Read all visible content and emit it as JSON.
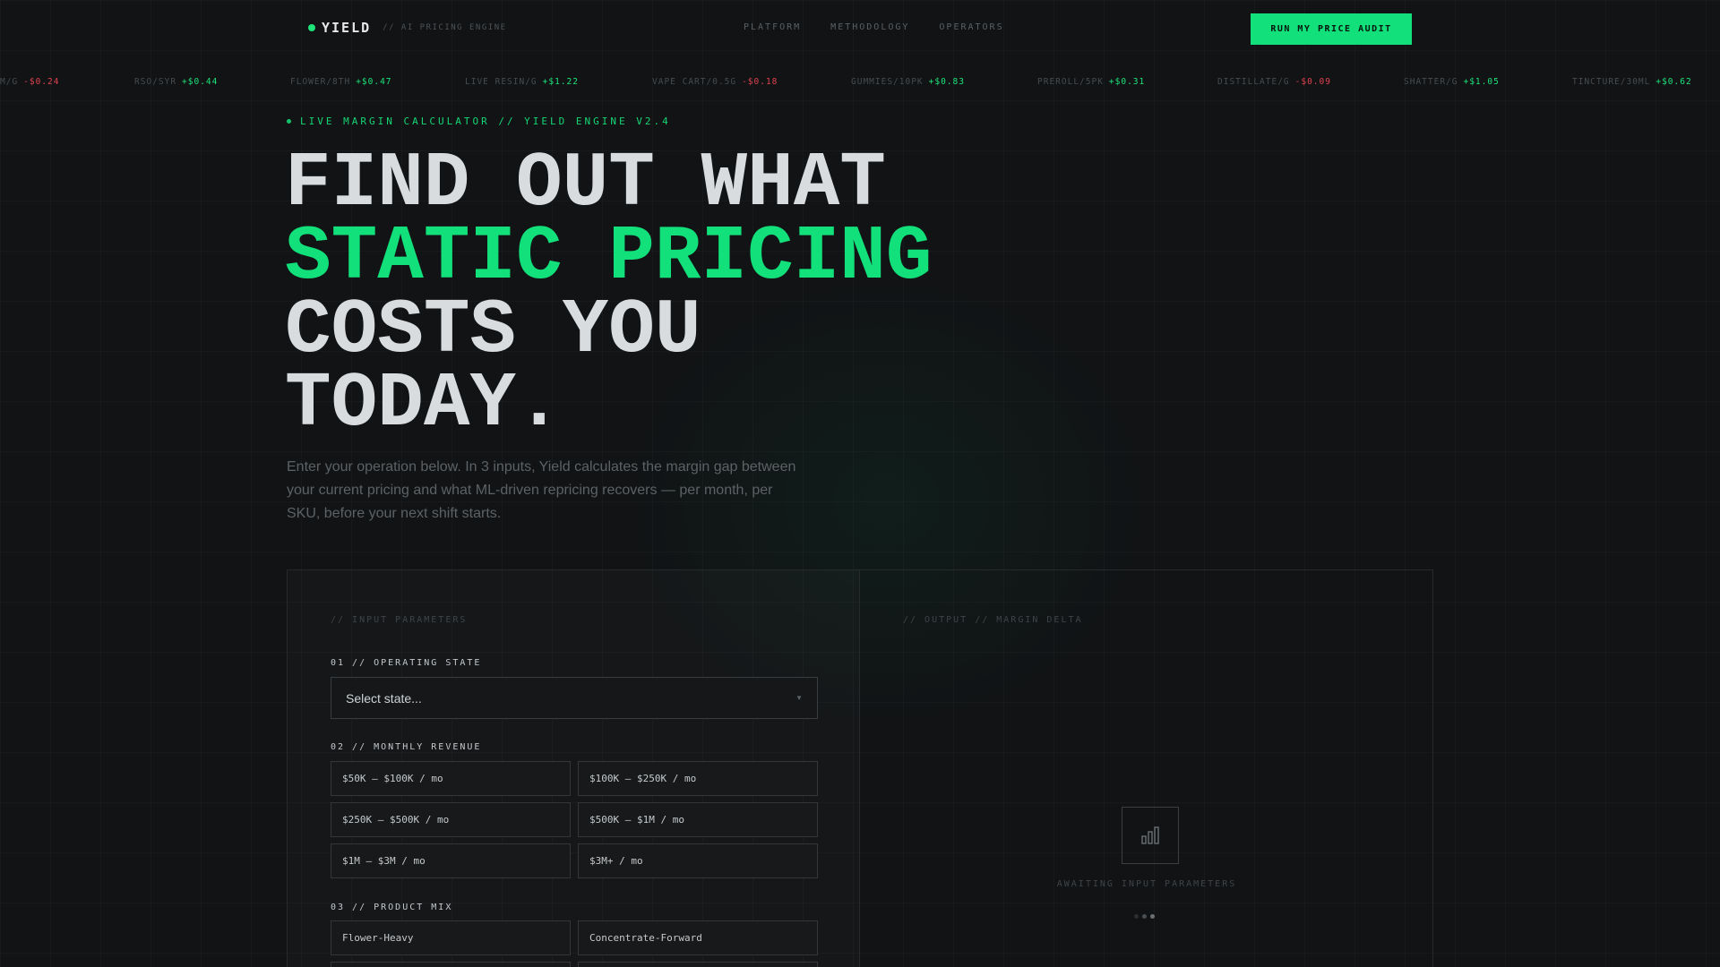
{
  "nav": {
    "logo": "YIELD",
    "tagline": "// AI PRICING ENGINE",
    "links": [
      "PLATFORM",
      "METHODOLOGY",
      "OPERATORS"
    ],
    "cta": "RUN MY PRICE AUDIT"
  },
  "ticker": [
    {
      "label": "M/G",
      "delta": "-$0.24",
      "dir": "down"
    },
    {
      "label": "RSO/SYR",
      "delta": "+$0.44",
      "dir": "up"
    },
    {
      "label": "FLOWER/8TH",
      "delta": "+$0.47",
      "dir": "up"
    },
    {
      "label": "LIVE RESIN/G",
      "delta": "+$1.22",
      "dir": "up"
    },
    {
      "label": "VAPE CART/0.5G",
      "delta": "-$0.18",
      "dir": "down"
    },
    {
      "label": "GUMMIES/10PK",
      "delta": "+$0.83",
      "dir": "up"
    },
    {
      "label": "PREROLL/5PK",
      "delta": "+$0.31",
      "dir": "up"
    },
    {
      "label": "DISTILLATE/G",
      "delta": "-$0.09",
      "dir": "down"
    },
    {
      "label": "SHATTER/G",
      "delta": "+$1.05",
      "dir": "up"
    },
    {
      "label": "TINCTURE/30ML",
      "delta": "+$0.62",
      "dir": "up"
    }
  ],
  "hero": {
    "eyebrow": "LIVE MARGIN CALCULATOR // YIELD ENGINE V2.4",
    "line1": "FIND OUT WHAT",
    "line2": "STATIC PRICING",
    "line3": "COSTS YOU",
    "line4": "TODAY.",
    "subtitle": "Enter your operation below. In 3 inputs, Yield calculates the margin gap between your current pricing and what ML-driven repricing recovers — per month, per SKU, before your next shift starts."
  },
  "calculator": {
    "input_comment": "// INPUT PARAMETERS",
    "output_comment": "// OUTPUT // MARGIN DELTA",
    "state_label": "01 // OPERATING STATE",
    "state_placeholder": "Select state...",
    "revenue_label": "02 // MONTHLY REVENUE",
    "revenue_options": [
      "$50K – $100K / mo",
      "$100K – $250K / mo",
      "$250K – $500K / mo",
      "$500K – $1M / mo",
      "$1M – $3M / mo",
      "$3M+ / mo"
    ],
    "mix_label": "03 // PRODUCT MIX",
    "mix_options": [
      "Flower-Heavy",
      "Concentrate-Forward"
    ],
    "await_text": "AWAITING INPUT PARAMETERS"
  },
  "colors": {
    "accent": "#12e07a",
    "negative": "#e0424f",
    "background": "#111315"
  }
}
